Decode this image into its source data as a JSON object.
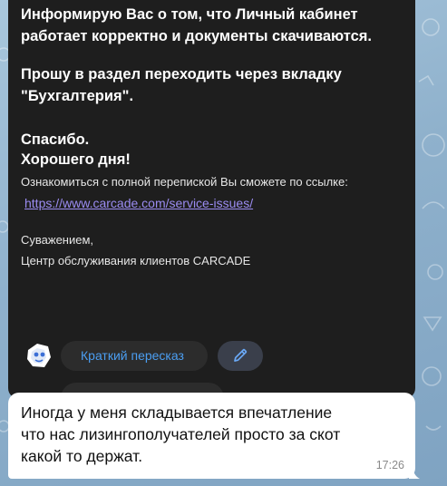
{
  "dark_message": {
    "line1": "Информирую Вас о том, что Личный кабинет",
    "line2": "работает корректно и документы скачиваются.",
    "line3": "Прошу в раздел переходить через вкладку",
    "line4": "\"Бухгалтерия\".",
    "line5": "Спасибо.",
    "line6": "Хорошего дня!",
    "line7": "Ознакомиться с полной перепиской Вы сможете по ссылке:",
    "link": "https://www.carcade.com/service-issues/",
    "line8": "Суважением,",
    "line9": "Центр обслуживания клиентов CARCADE"
  },
  "actions": {
    "summary_label": "Краткий пересказ",
    "summary_icon": "summary-logo-icon",
    "edit_icon": "pencil-icon",
    "accent_color": "#4b9ef2"
  },
  "reply_message": {
    "line1": "Иногда у меня складывается впечатление",
    "line2": "что нас лизингополучателей просто за скот",
    "line3": "какой то держат.",
    "time": "17:26"
  }
}
